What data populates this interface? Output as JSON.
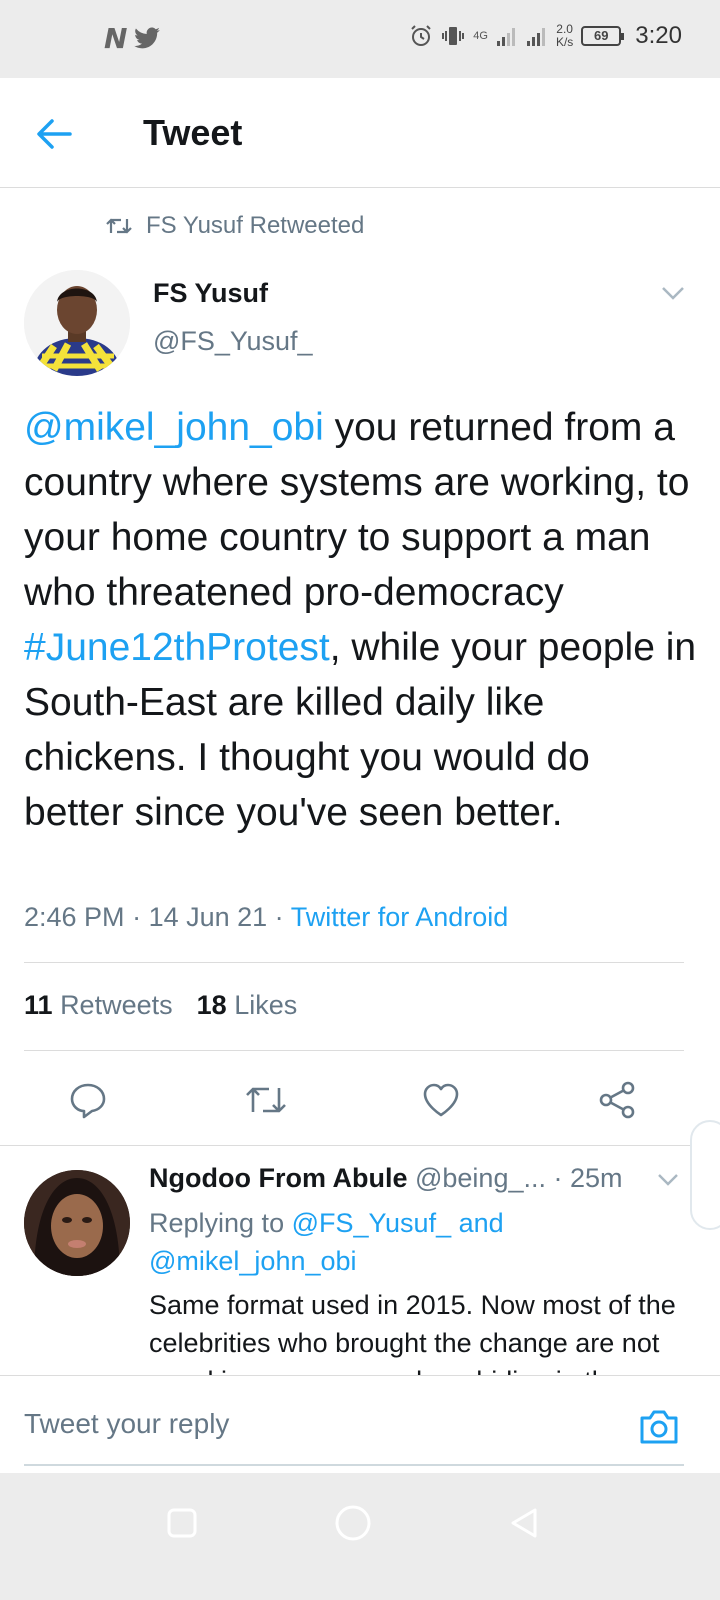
{
  "status_bar": {
    "time": "3:20",
    "battery": "69",
    "net_speed_value": "2.0",
    "net_speed_unit": "K/s",
    "network": "4G",
    "left_icons": [
      "notification-icon",
      "twitter-icon"
    ],
    "right_icons": [
      "alarm-icon",
      "vibrate-icon",
      "signal-icon",
      "signal-icon-2"
    ]
  },
  "header": {
    "title": "Tweet",
    "back_icon": "arrow-left-icon"
  },
  "retweet_banner": {
    "text": "FS Yusuf Retweeted"
  },
  "tweet": {
    "author_name": "FS Yusuf",
    "author_handle": "@FS_Yusuf_",
    "text_parts": {
      "mention": "@mikel_john_obi",
      "part1": " you returned from a country where systems are working, to your home country to support a man who threatened pro-democracy ",
      "hashtag": "#June12thProtest",
      "part2": ", while your people in South-East are killed daily like chickens. I thought you would do better since you've seen better."
    },
    "time": "2:46 PM",
    "date": "14 Jun 21",
    "separator": " · ",
    "source": "Twitter for Android",
    "retweets_count": "11",
    "retweets_label": "Retweets",
    "likes_count": "18",
    "likes_label": "Likes"
  },
  "reply": {
    "name": "Ngodoo From Abule",
    "handle": "@being_...",
    "time": "· 25m",
    "replying_prefix": "Replying to ",
    "replying_user1": "@FS_Yusuf_",
    "replying_and": " and",
    "replying_user2": "@mikel_john_obi",
    "text": "Same format used in 2015. Now most of the celebrities who brought the change are not speaking anymore and are hiding in the"
  },
  "composer": {
    "placeholder": "Tweet your reply"
  },
  "colors": {
    "accent": "#1da1f2",
    "secondary_text": "#657786",
    "primary_text": "#14171a"
  }
}
